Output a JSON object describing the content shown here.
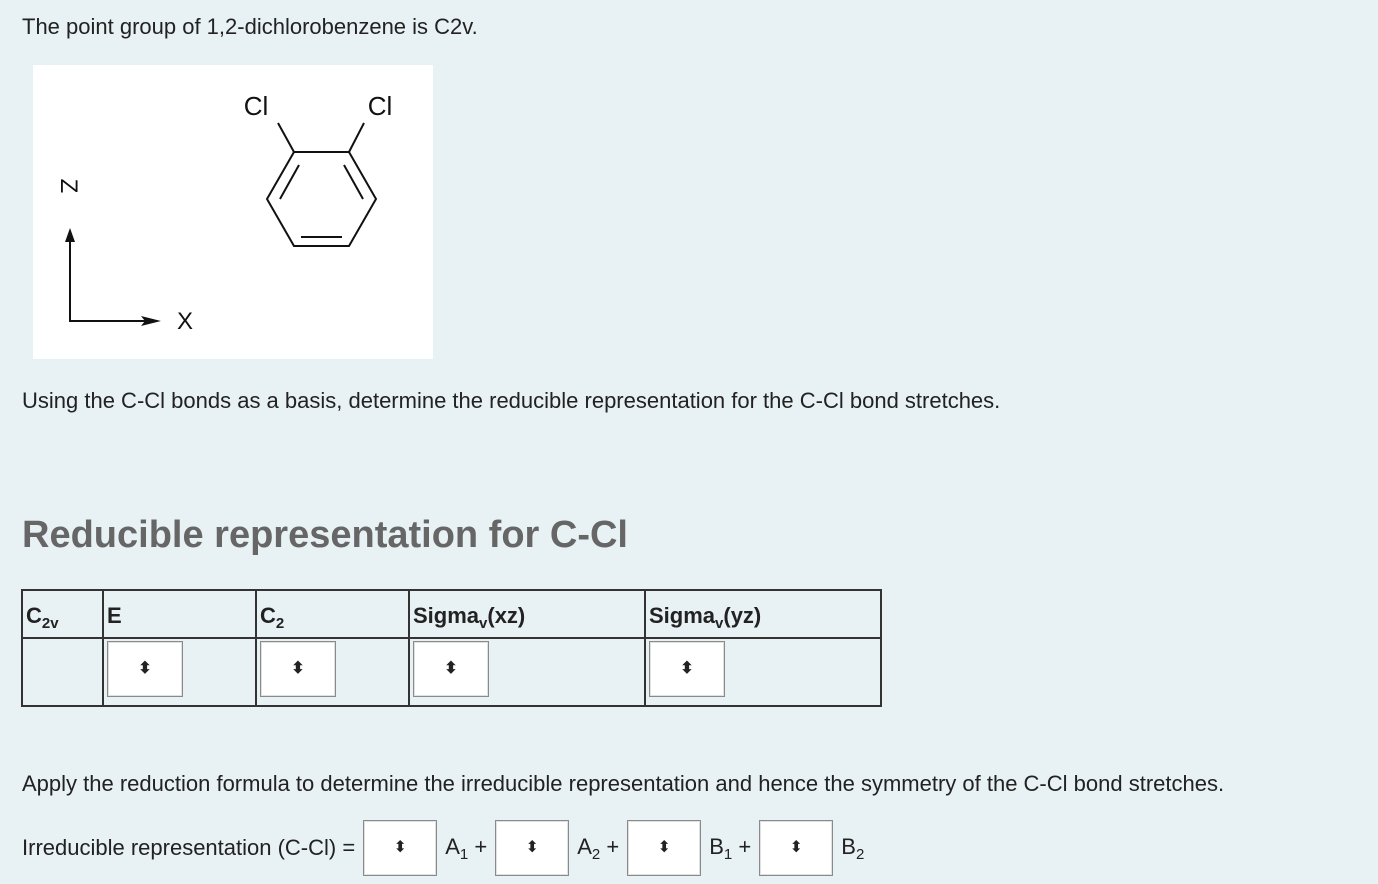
{
  "intro": "The point group of 1,2-dichlorobenzene is C2v.",
  "figure": {
    "cl_left": "Cl",
    "cl_right": "Cl",
    "axis_z": "Z",
    "axis_x": "X"
  },
  "question": "Using the C-Cl bonds as a basis, determine the reducible representation for the C-Cl bond stretches.",
  "heading": "Reducible representation for C-Cl",
  "table": {
    "pg_main": "C",
    "pg_sub": "2v",
    "col_e": "E",
    "col_c2_main": "C",
    "col_c2_sub": "2",
    "col_sxz_pre": "Sigma",
    "col_sxz_sub": "v",
    "col_sxz_post": "(xz)",
    "col_syz_pre": "Sigma",
    "col_syz_sub": "v",
    "col_syz_post": "(yz)"
  },
  "reduction_text": "Apply the reduction formula to determine the irreducible representation and hence the symmetry of the C-Cl bond stretches.",
  "irreducible": {
    "label": "Irreducible representation (C-Cl) =",
    "a1_main": "A",
    "a1_sub": "1",
    "a1_op": "+",
    "a2_main": "A",
    "a2_sub": "2",
    "a2_op": "+",
    "b1_main": "B",
    "b1_sub": "1",
    "b1_op": "+",
    "b2_main": "B",
    "b2_sub": "2"
  },
  "select_arrow": "⬍"
}
